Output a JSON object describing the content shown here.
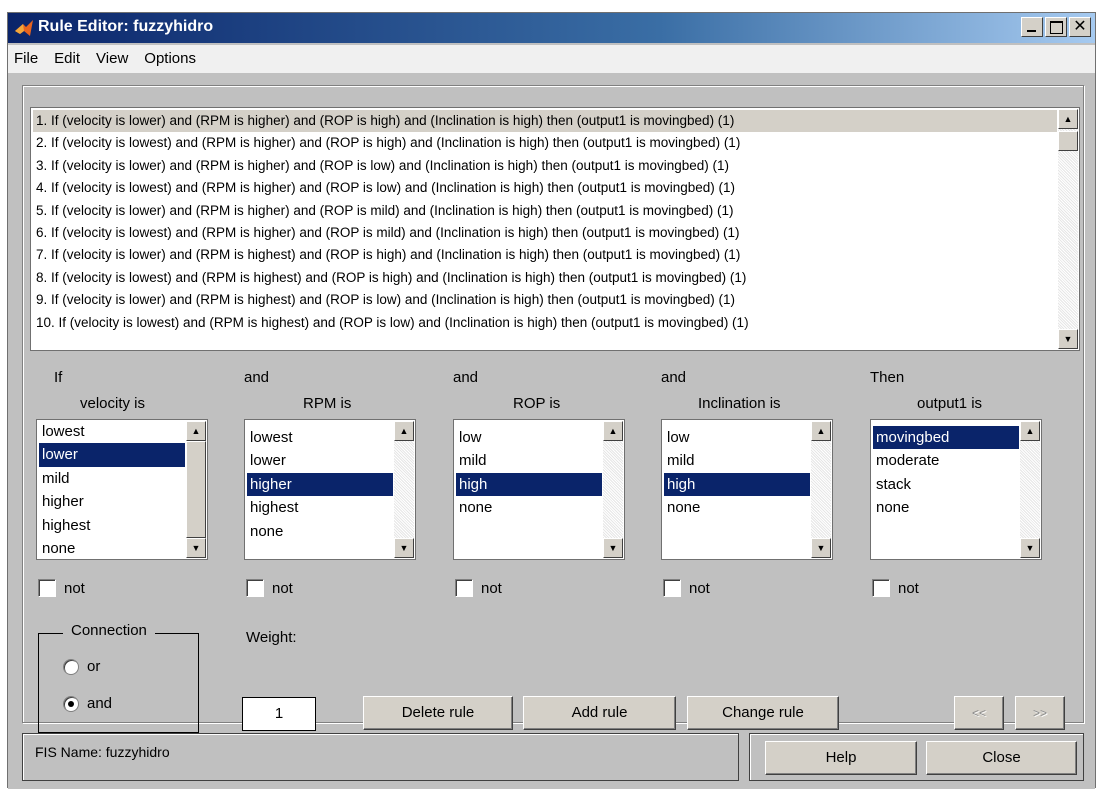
{
  "window": {
    "title": "Rule Editor: fuzzyhidro"
  },
  "menu": [
    "File",
    "Edit",
    "View",
    "Options"
  ],
  "rules": [
    "1. If (velocity is lower) and (RPM is higher) and (ROP is high) and (Inclination is high) then (output1 is movingbed) (1)",
    "2. If (velocity is lowest) and (RPM is higher) and (ROP is high) and (Inclination is high) then (output1 is movingbed) (1)",
    "3. If (velocity is lower) and (RPM is higher) and (ROP is low) and (Inclination is high) then (output1 is movingbed) (1)",
    "4. If (velocity is lowest) and (RPM is higher) and (ROP is low) and (Inclination is high) then (output1 is movingbed) (1)",
    "5. If (velocity is lower) and (RPM is higher) and (ROP is mild) and (Inclination is high) then (output1 is movingbed) (1)",
    "6. If (velocity is lowest) and (RPM is higher) and (ROP is mild) and (Inclination is high) then (output1 is movingbed) (1)",
    "7. If (velocity is lower) and (RPM is highest) and (ROP is high) and (Inclination is high) then (output1 is movingbed) (1)",
    "8. If (velocity is lowest) and (RPM is highest) and (ROP is high) and (Inclination is high) then (output1 is movingbed) (1)",
    "9. If (velocity is lower) and (RPM is highest) and (ROP is low) and (Inclination is high) then (output1 is movingbed) (1)",
    "10. If (velocity is lowest) and (RPM is highest) and (ROP is low) and (Inclination is high) then (output1 is movingbed) (1)"
  ],
  "selected_rule": 1,
  "columns": [
    {
      "connector": "If",
      "label": "velocity is",
      "options": [
        "lowest",
        "lower",
        "mild",
        "higher",
        "highest",
        "none"
      ],
      "selected": "lower",
      "not_label": "not"
    },
    {
      "connector": "and",
      "label": "RPM is",
      "options": [
        "lowest",
        "lower",
        "higher",
        "highest",
        "none"
      ],
      "selected": "higher",
      "not_label": "not"
    },
    {
      "connector": "and",
      "label": "ROP is",
      "options": [
        "low",
        "mild",
        "high",
        "none"
      ],
      "selected": "high",
      "not_label": "not"
    },
    {
      "connector": "and",
      "label": "Inclination is",
      "options": [
        "low",
        "mild",
        "high",
        "none"
      ],
      "selected": "high",
      "not_label": "not"
    },
    {
      "connector": "Then",
      "label": "output1 is",
      "options": [
        "movingbed",
        "moderate",
        "stack",
        "none"
      ],
      "selected": "movingbed",
      "not_label": "not"
    }
  ],
  "connection": {
    "title": "Connection",
    "options": [
      "or",
      "and"
    ],
    "selected": "and"
  },
  "weight": {
    "label": "Weight:",
    "value": "1"
  },
  "buttons": {
    "delete_rule": "Delete rule",
    "add_rule": "Add rule",
    "change_rule": "Change rule",
    "prev": "<<",
    "next": ">>",
    "help": "Help",
    "close": "Close"
  },
  "status": "FIS Name: fuzzyhidro",
  "colors": {
    "titlebar": "#0a246a",
    "selection": "#0a246a",
    "panel": "#c0c0c0",
    "app_icon": "#e8641e"
  }
}
